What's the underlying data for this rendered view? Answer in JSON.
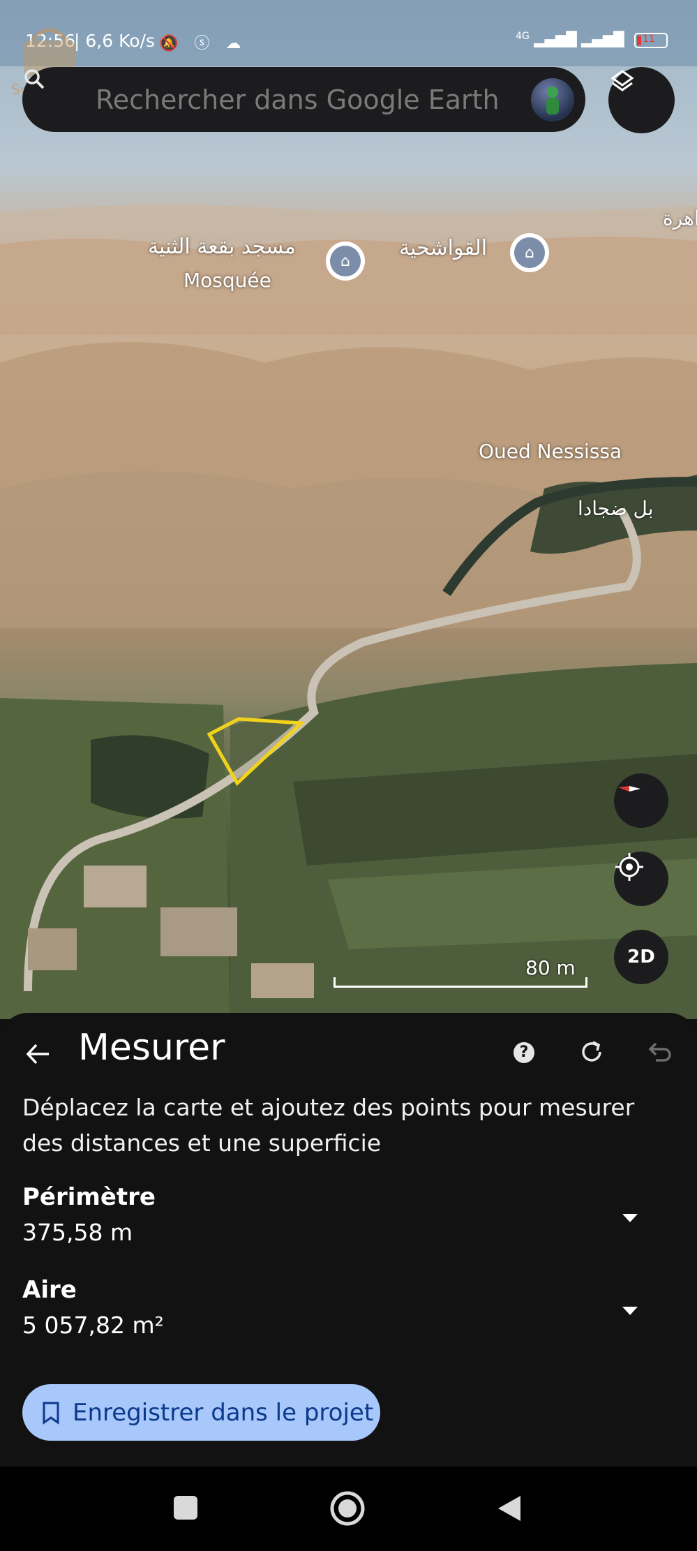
{
  "status_bar": {
    "time": "12:56",
    "speed": "| 6,6 Ko/s",
    "network": "4G",
    "battery": "11"
  },
  "watermark": {
    "text": "Swiga | سويقة"
  },
  "search": {
    "placeholder": "Rechercher dans Google Earth"
  },
  "map": {
    "labels": {
      "mosque_arabic": "مسجد بقعة الثنية",
      "mosque_french": "Mosquée",
      "place_arabic": "القواشحية",
      "edge_arabic": "اهرة",
      "river": "Oued Nessissa",
      "village_arabic": "بل ضجادا"
    },
    "scale": "80 m",
    "buttons": {
      "mode_2d": "2D"
    }
  },
  "panel": {
    "title": "Mesurer",
    "help": "?",
    "instructions": "Déplacez la carte et ajoutez des points pour mesurer des distances et une superficie",
    "perimeter_label": "Périmètre",
    "perimeter_value": "375,58 m",
    "area_label": "Aire",
    "area_value": "5 057,82 m²",
    "save_button": "Enregistrer dans le projet"
  },
  "colors": {
    "panel_bg": "#121212",
    "save_button_bg": "#a8c7fa",
    "save_button_text": "#0b3a8c",
    "polygon": "#f2d21b"
  },
  "icons": [
    "search-icon",
    "layers-icon",
    "compass-icon",
    "my-location-icon",
    "back-arrow-icon",
    "help-icon",
    "refresh-icon",
    "undo-icon",
    "bookmark-icon",
    "recents-icon",
    "home-icon",
    "back-nav-icon"
  ]
}
